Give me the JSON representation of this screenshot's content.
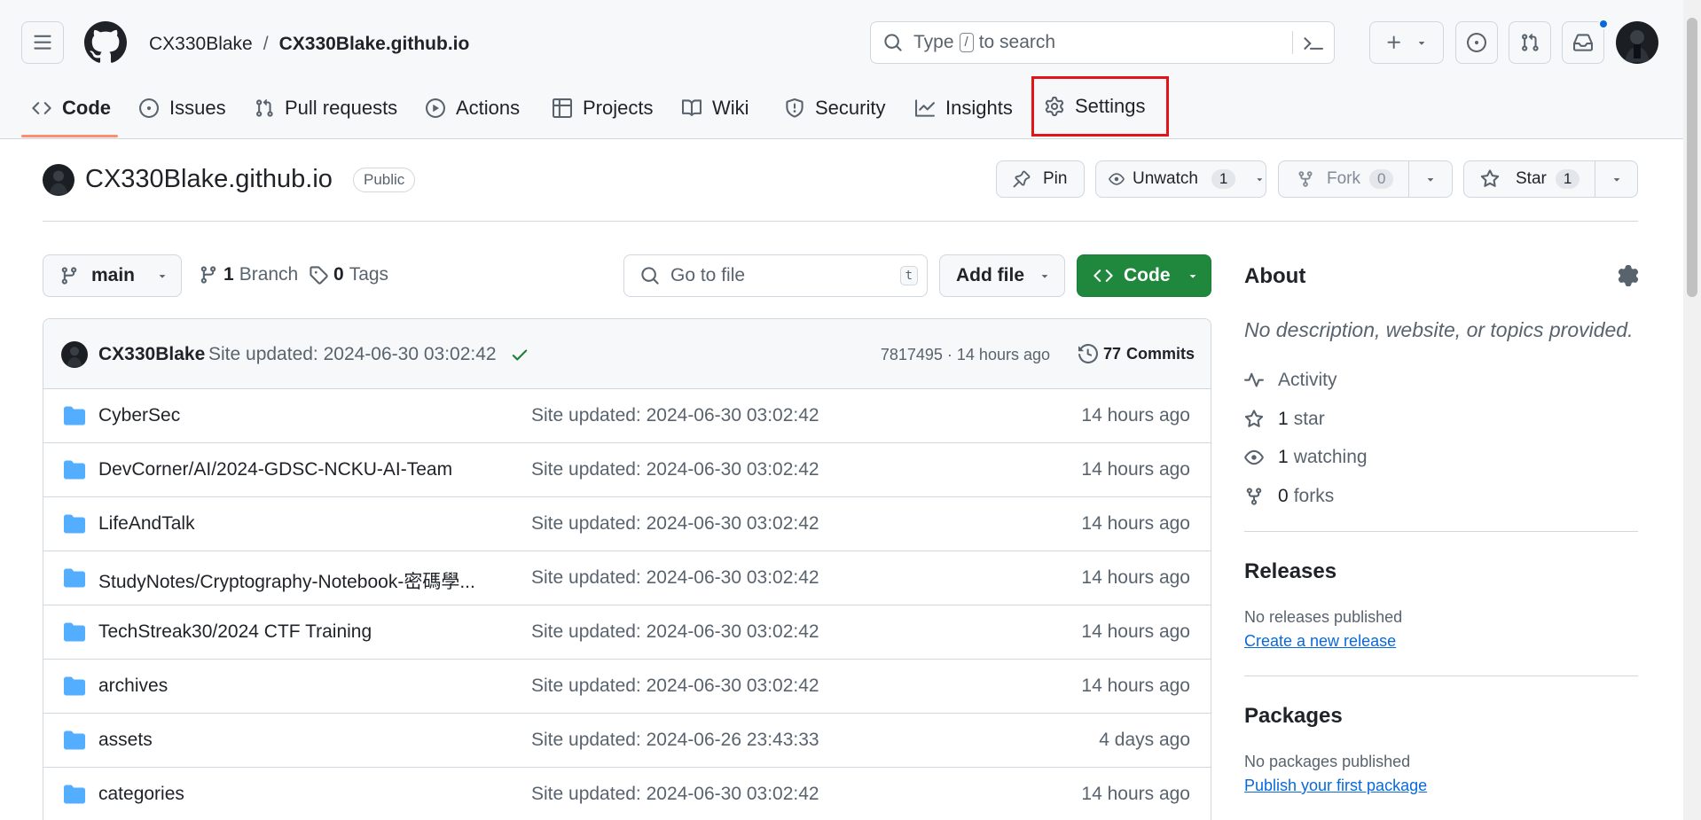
{
  "header": {
    "owner": "CX330Blake",
    "separator": "/",
    "repo": "CX330Blake.github.io",
    "search_type": "Type",
    "search_key": "/",
    "search_rest": "to search"
  },
  "nav": {
    "tabs": [
      {
        "label": "Code"
      },
      {
        "label": "Issues"
      },
      {
        "label": "Pull requests"
      },
      {
        "label": "Actions"
      },
      {
        "label": "Projects"
      },
      {
        "label": "Wiki"
      },
      {
        "label": "Security"
      },
      {
        "label": "Insights"
      },
      {
        "label": "Settings"
      }
    ],
    "active_tab": "Code",
    "highlighted_tab": "Settings"
  },
  "repo_header": {
    "name": "CX330Blake.github.io",
    "visibility": "Public",
    "pin_label": "Pin",
    "unwatch_label": "Unwatch",
    "watch_count": "1",
    "fork_label": "Fork",
    "fork_count": "0",
    "star_label": "Star",
    "star_count": "1"
  },
  "toolbar": {
    "branch": "main",
    "branch_count": "1",
    "branch_label": "Branch",
    "tag_count": "0",
    "tag_label": "Tags",
    "goto_placeholder": "Go to file",
    "goto_key": "t",
    "add_file_label": "Add file",
    "code_label": "Code"
  },
  "commit": {
    "author": "CX330Blake",
    "message": "Site updated: 2024-06-30 03:02:42",
    "hash": "7817495",
    "dot": "·",
    "time": "14 hours ago",
    "commit_count": "77",
    "commit_label": "Commits"
  },
  "files": [
    {
      "name": "CyberSec",
      "message": "Site updated: 2024-06-30 03:02:42",
      "time": "14 hours ago"
    },
    {
      "name": "DevCorner/AI/2024-GDSC-NCKU-AI-Team",
      "message": "Site updated: 2024-06-30 03:02:42",
      "time": "14 hours ago"
    },
    {
      "name": "LifeAndTalk",
      "message": "Site updated: 2024-06-30 03:02:42",
      "time": "14 hours ago"
    },
    {
      "name": "StudyNotes/Cryptography-Notebook-密碼學...",
      "message": "Site updated: 2024-06-30 03:02:42",
      "time": "14 hours ago"
    },
    {
      "name": "TechStreak30/2024 CTF Training",
      "message": "Site updated: 2024-06-30 03:02:42",
      "time": "14 hours ago"
    },
    {
      "name": "archives",
      "message": "Site updated: 2024-06-30 03:02:42",
      "time": "14 hours ago"
    },
    {
      "name": "assets",
      "message": "Site updated: 2024-06-26 23:43:33",
      "time": "4 days ago"
    },
    {
      "name": "categories",
      "message": "Site updated: 2024-06-30 03:02:42",
      "time": "14 hours ago"
    }
  ],
  "about": {
    "title": "About",
    "description": "No description, website, or topics provided.",
    "activity": "Activity",
    "star_count": "1",
    "star_label": "star",
    "watching_count": "1",
    "watching_label": "watching",
    "forks_count": "0",
    "forks_label": "forks"
  },
  "releases": {
    "title": "Releases",
    "empty": "No releases published",
    "link": "Create a new release"
  },
  "packages": {
    "title": "Packages",
    "empty": "No packages published",
    "link": "Publish your first package"
  },
  "colors": {
    "accent_green": "#1f883d",
    "link_blue": "#0969da",
    "highlight_red": "#e3131b",
    "folder_blue": "#54aeff",
    "active_underline": "#fd8c73"
  }
}
